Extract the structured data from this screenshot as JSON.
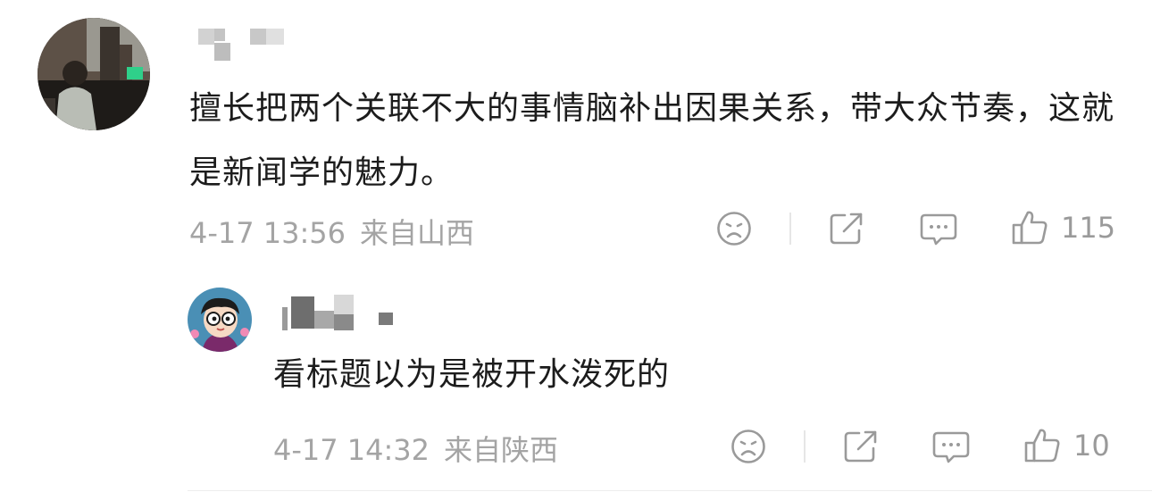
{
  "comments": [
    {
      "text": "擅长把两个关联不大的事情脑补出因果关系，带大众节奏，这就是新闻学的魅力。",
      "time": "4-17 13:56",
      "location": "来自山西",
      "likes": "115",
      "icons": [
        "sad-face-icon",
        "share-icon",
        "comment-icon",
        "thumbs-up-icon"
      ]
    },
    {
      "text": "看标题以为是被开水泼死的",
      "time": "4-17 14:32",
      "location": "来自陕西",
      "likes": "10",
      "icons": [
        "sad-face-icon",
        "share-icon",
        "comment-icon",
        "thumbs-up-icon"
      ]
    }
  ],
  "colors": {
    "text": "#1c1c1c",
    "meta": "#a4a4a4",
    "icon": "#9a9a9a"
  }
}
